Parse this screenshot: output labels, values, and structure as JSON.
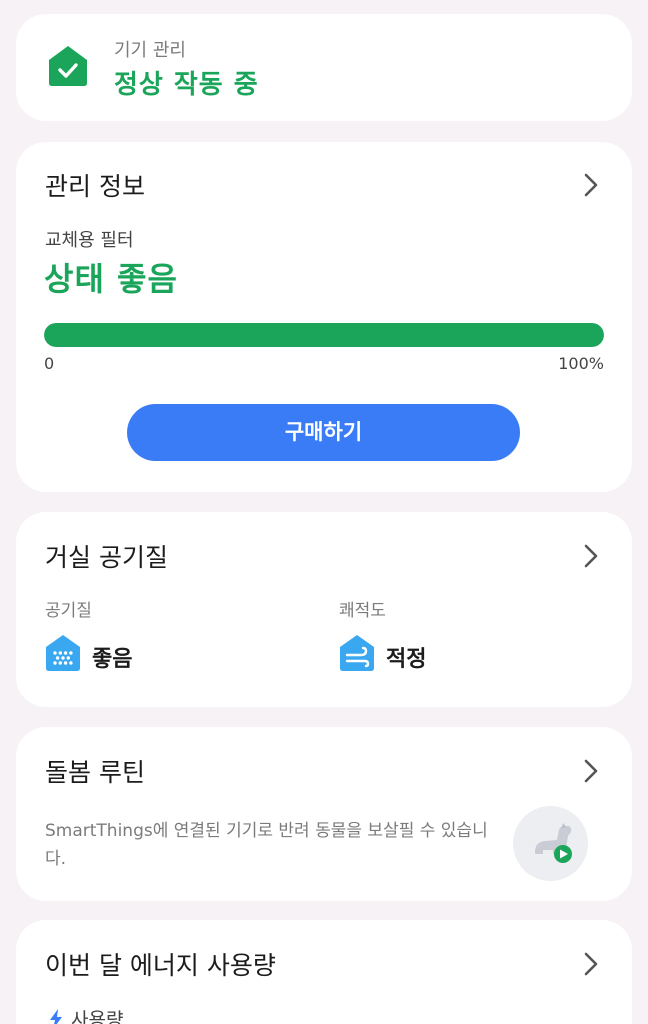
{
  "device_status": {
    "label": "기기 관리",
    "value": "정상 작동 중",
    "icon": "home-check-icon",
    "color": "#1aa55a"
  },
  "management": {
    "title": "관리 정보",
    "filter_label": "교체용 필터",
    "filter_status": "상태 좋음",
    "filter_level_percent": 100,
    "range_min": "0",
    "range_max": "100%",
    "buy_label": "구매하기",
    "accent": "#3a7cf6"
  },
  "air_quality": {
    "title": "거실 공기질",
    "metrics": [
      {
        "label": "공기질",
        "value": "좋음",
        "icon": "air-quality-icon"
      },
      {
        "label": "쾌적도",
        "value": "적정",
        "icon": "comfort-wind-icon"
      }
    ]
  },
  "care_routine": {
    "title": "돌봄 루틴",
    "description": "SmartThings에 연결된 기기로 반려 동물을 보살필 수 있습니다.",
    "icon": "pet-play-icon"
  },
  "energy": {
    "title": "이번 달 에너지 사용량",
    "usage_label": "사용량",
    "icon": "lightning-icon"
  }
}
